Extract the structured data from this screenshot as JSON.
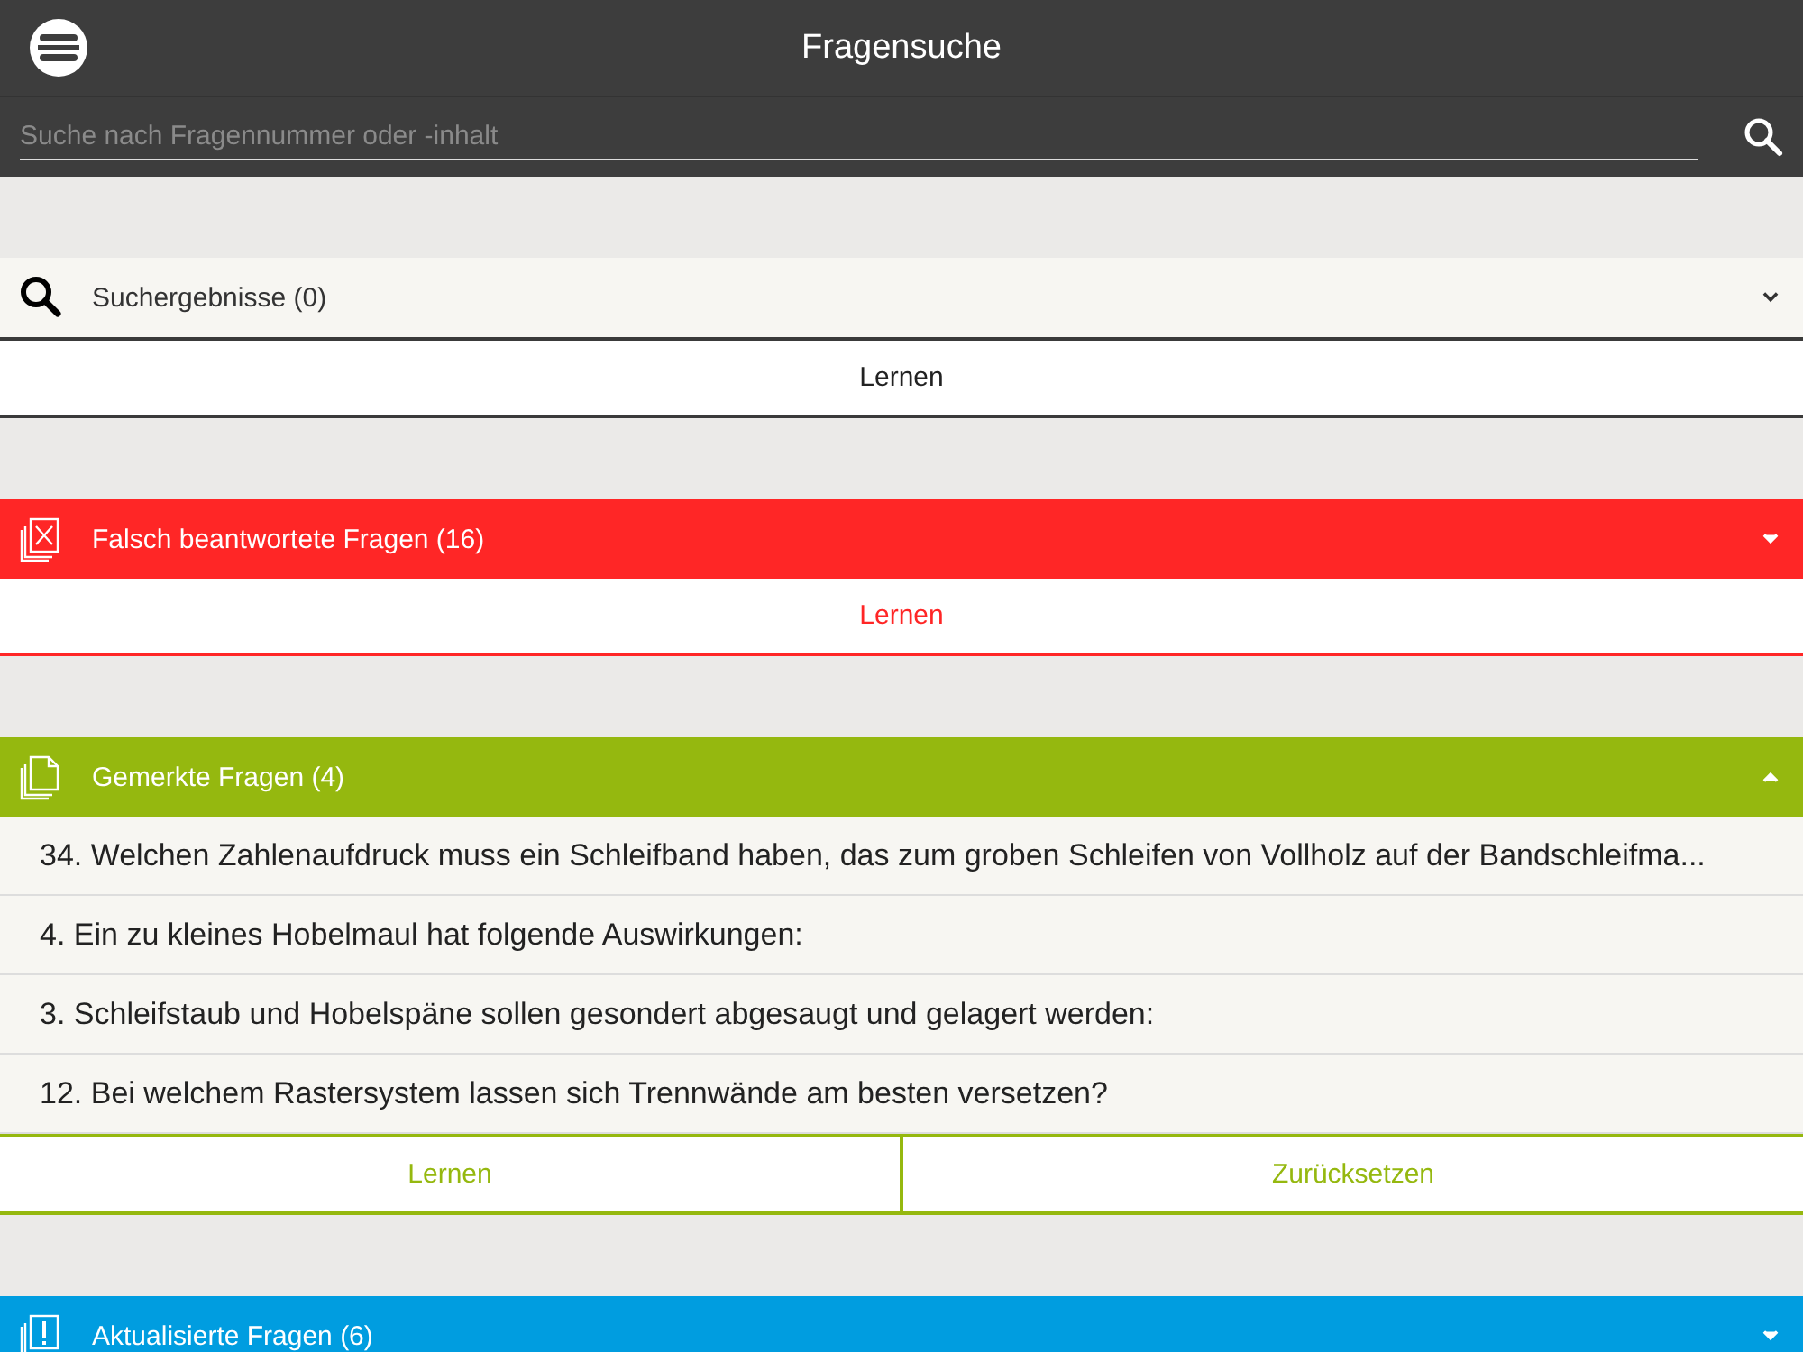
{
  "header": {
    "title": "Fragensuche"
  },
  "search": {
    "placeholder": "Suche nach Fragennummer oder -inhalt"
  },
  "sections": [
    {
      "kind": "search",
      "title": "Suchergebnisse (0)",
      "color": "#3a3a3a",
      "expanded": false,
      "actions": [
        "Lernen"
      ]
    },
    {
      "kind": "wrong",
      "title": "Falsch beantwortete Fragen (16)",
      "color": "#ff2626",
      "expanded": false,
      "actions": [
        "Lernen"
      ]
    },
    {
      "kind": "marked",
      "title": "Gemerkte Fragen (4)",
      "color": "#95b80f",
      "expanded": true,
      "items": [
        "34. Welchen Zahlenaufdruck muss ein Schleifband haben, das zum groben Schleifen von Vollholz auf der Bandschleifma...",
        "4. Ein zu kleines Hobelmaul hat folgende Auswirkungen:",
        "3. Schleifstaub und Hobelspäne sollen gesondert abgesaugt und gelagert werden:",
        "12. Bei welchem Rastersystem lassen sich Trennwände am besten versetzen?"
      ],
      "actions": [
        "Lernen",
        "Zurücksetzen"
      ]
    },
    {
      "kind": "updated",
      "title": "Aktualisierte Fragen (6)",
      "color": "#009de0",
      "expanded": false
    }
  ]
}
